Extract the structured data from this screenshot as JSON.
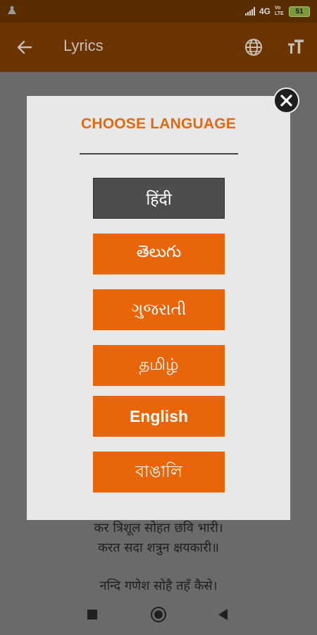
{
  "status_bar": {
    "network": "4G",
    "lte": "Vo LTE",
    "battery": "51"
  },
  "app_bar": {
    "title": "Lyrics",
    "back_icon": "arrow-left-icon",
    "language_icon": "globe-icon",
    "text_size_icon": "text-size-icon"
  },
  "lyrics": {
    "lines": [
      "कर त्रिशूल सोहत छवि भारी।",
      "करत सदा शत्रुन क्षयकारी॥",
      "नन्दि गणेश सोहै तहँ कैसे।"
    ]
  },
  "dialog": {
    "title": "CHOOSE LANGUAGE",
    "languages": [
      {
        "label": "हिंदी",
        "selected": true
      },
      {
        "label": "తెలుగు",
        "selected": false
      },
      {
        "label": "ગુજરાતી",
        "selected": false
      },
      {
        "label": "தமிழ்",
        "selected": false
      },
      {
        "label": "English",
        "selected": false
      },
      {
        "label": "বাঙালি",
        "selected": false
      }
    ],
    "close_icon": "close-icon"
  },
  "colors": {
    "accent": "#e8650a",
    "selected": "#4d4d4d",
    "app_bar": "#6b3400"
  }
}
